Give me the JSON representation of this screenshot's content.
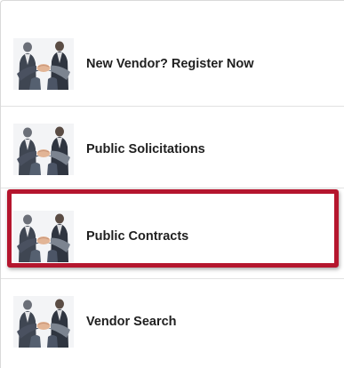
{
  "menu": {
    "items": [
      {
        "label": "New Vendor? Register Now",
        "icon": "handshake-icon"
      },
      {
        "label": "Public Solicitations",
        "icon": "handshake-icon"
      },
      {
        "label": "Public Contracts",
        "icon": "handshake-icon"
      },
      {
        "label": "Vendor Search",
        "icon": "handshake-icon"
      }
    ],
    "highlight_color": "#b5162e"
  }
}
